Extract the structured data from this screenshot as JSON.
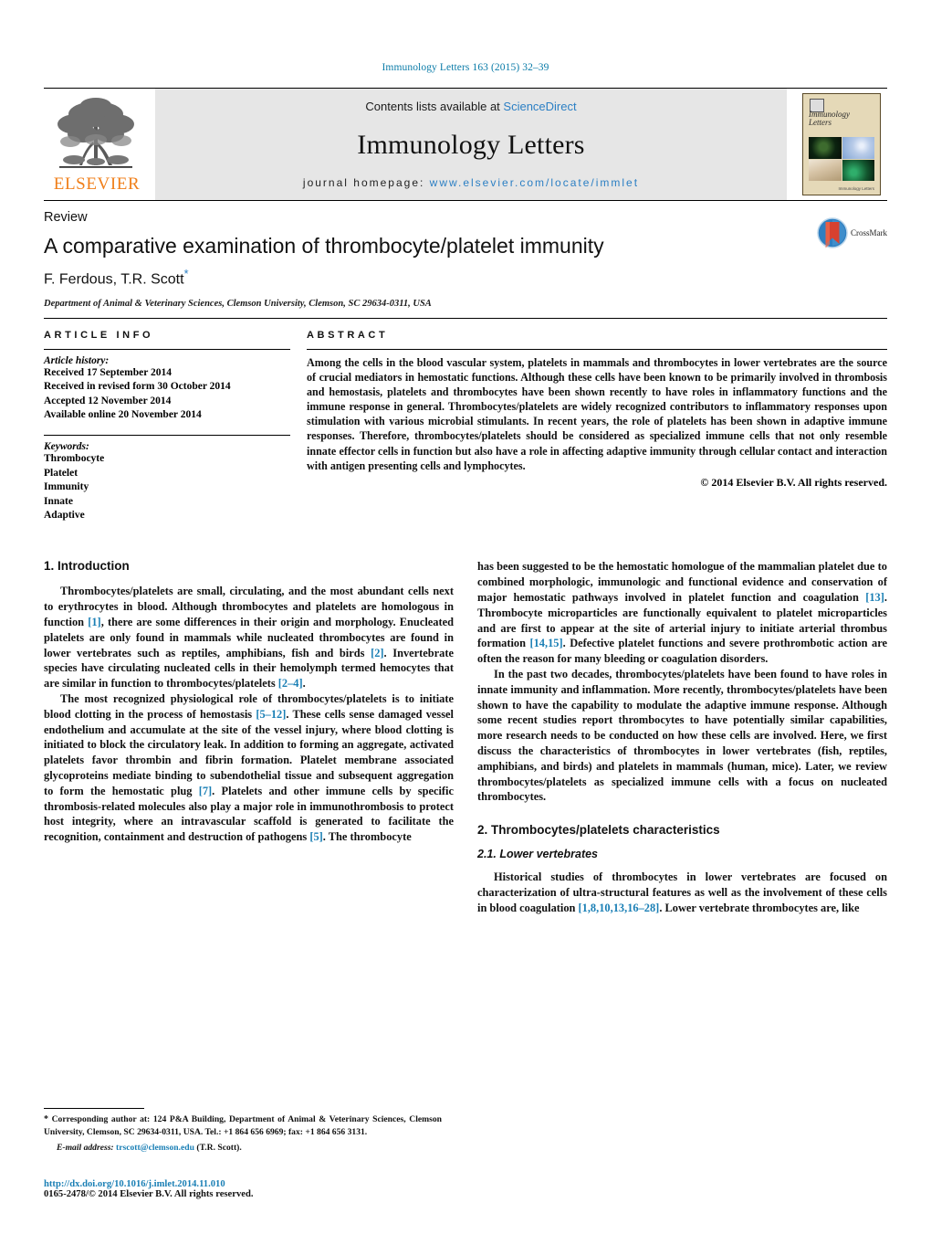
{
  "running_head": "Immunology Letters 163 (2015) 32–39",
  "masthead": {
    "publisher_name": "ELSEVIER",
    "contents_prefix": "Contents lists available at ",
    "contents_link": "ScienceDirect",
    "journal_title": "Immunology Letters",
    "homepage_prefix": "journal homepage: ",
    "homepage_url": "www.elsevier.com/locate/immlet",
    "cover": {
      "title": "Immunology Letters",
      "foot_left": "",
      "foot_right": "Immunology Letters"
    }
  },
  "article": {
    "doctype": "Review",
    "title": "A comparative examination of thrombocyte/platelet immunity",
    "authors": "F. Ferdous, T.R. Scott",
    "author_star": "*",
    "affiliation": "Department of Animal & Veterinary Sciences, Clemson University, Clemson, SC 29634-0311, USA",
    "crossmark_label": "CrossMark"
  },
  "article_info": {
    "label": "ARTICLE INFO",
    "history_head": "Article history:",
    "history": [
      "Received 17 September 2014",
      "Received in revised form 30 October 2014",
      "Accepted 12 November 2014",
      "Available online 20 November 2014"
    ],
    "keywords_head": "Keywords:",
    "keywords": [
      "Thrombocyte",
      "Platelet",
      "Immunity",
      "Innate",
      "Adaptive"
    ]
  },
  "abstract": {
    "label": "ABSTRACT",
    "text": "Among the cells in the blood vascular system, platelets in mammals and thrombocytes in lower vertebrates are the source of crucial mediators in hemostatic functions. Although these cells have been known to be primarily involved in thrombosis and hemostasis, platelets and thrombocytes have been shown recently to have roles in inflammatory functions and the immune response in general. Thrombocytes/platelets are widely recognized contributors to inflammatory responses upon stimulation with various microbial stimulants. In recent years, the role of platelets has been shown in adaptive immune responses. Therefore, thrombocytes/platelets should be considered as specialized immune cells that not only resemble innate effector cells in function but also have a role in affecting adaptive immunity through cellular contact and interaction with antigen presenting cells and lymphocytes.",
    "copyright": "© 2014 Elsevier B.V. All rights reserved."
  },
  "body": {
    "section1_heading": "1. Introduction",
    "p1_a": "Thrombocytes/platelets are small, circulating, and the most abundant cells next to erythrocytes in blood. Although thrombocytes and platelets are homologous in function ",
    "p1_r1": "[1]",
    "p1_b": ", there are some differences in their origin and morphology. Enucleated platelets are only found in mammals while nucleated thrombocytes are found in lower vertebrates such as reptiles, amphibians, fish and birds ",
    "p1_r2": "[2]",
    "p1_c": ". Invertebrate species have circulating nucleated cells in their hemolymph termed hemocytes that are similar in function to thrombocytes/platelets ",
    "p1_r3": "[2–4]",
    "p1_d": ".",
    "p2_a": "The most recognized physiological role of thrombocytes/platelets is to initiate blood clotting in the process of hemostasis ",
    "p2_r1": "[5–12]",
    "p2_b": ". These cells sense damaged vessel endothelium and accumulate at the site of the vessel injury, where blood clotting is initiated to block the circulatory leak. In addition to forming an aggregate, activated platelets favor thrombin and fibrin formation. Platelet membrane associated glycoproteins mediate binding to subendothelial tissue and subsequent aggregation to form the hemostatic plug ",
    "p2_r2": "[7]",
    "p2_c": ". Platelets and other immune cells by specific thrombosis-related molecules also play a major role in immunothrombosis to protect host integrity, where an intravascular scaffold is generated to facilitate the recognition, containment and destruction of pathogens ",
    "p2_r3": "[5]",
    "p2_d": ". The thrombocyte",
    "p3_a": "has been suggested to be the hemostatic homologue of the mammalian platelet due to combined morphologic, immunologic and functional evidence and conservation of major hemostatic pathways involved in platelet function and coagulation ",
    "p3_r1": "[13]",
    "p3_b": ". Thrombocyte microparticles are functionally equivalent to platelet microparticles and are first to appear at the site of arterial injury to initiate arterial thrombus formation ",
    "p3_r2": "[14,15]",
    "p3_c": ". Defective platelet functions and severe prothrombotic action are often the reason for many bleeding or coagulation disorders.",
    "p4": "In the past two decades, thrombocytes/platelets have been found to have roles in innate immunity and inflammation. More recently, thrombocytes/platelets have been shown to have the capability to modulate the adaptive immune response. Although some recent studies report thrombocytes to have potentially similar capabilities, more research needs to be conducted on how these cells are involved. Here, we first discuss the characteristics of thrombocytes in lower vertebrates (fish, reptiles, amphibians, and birds) and platelets in mammals (human, mice). Later, we review thrombocytes/platelets as specialized immune cells with a focus on nucleated thrombocytes.",
    "section2_heading": "2. Thrombocytes/platelets characteristics",
    "subsection21_heading": "2.1. Lower vertebrates",
    "p5_a": "Historical studies of thrombocytes in lower vertebrates are focused on characterization of ultra-structural features as well as the involvement of these cells in blood coagulation ",
    "p5_r1": "[1,8,10,13,16–28]",
    "p5_b": ". Lower vertebrate thrombocytes are, like"
  },
  "footnote": {
    "star": "*",
    "text": " Corresponding author at: 124 P&A Building, Department of Animal & Veterinary Sciences, Clemson University, Clemson, SC 29634-0311, USA. Tel.: +1 864 656 6969; fax: +1 864 656 3131.",
    "email_label": "E-mail address:",
    "email": "trscott@clemson.edu",
    "email_suffix": "(T.R. Scott).",
    "doi": "http://dx.doi.org/10.1016/j.imlet.2014.11.010",
    "issn": "0165-2478/© 2014 Elsevier B.V. All rights reserved."
  },
  "colors": {
    "link": "#1a7fb5",
    "elsevier_orange": "#f07f1a",
    "band_gray": "#e6e6e6"
  }
}
